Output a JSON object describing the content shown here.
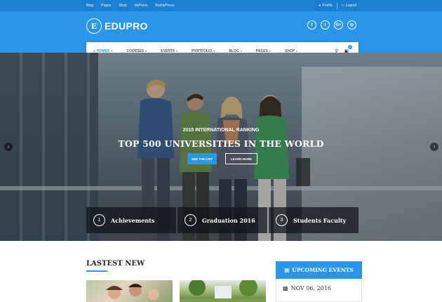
{
  "topbar": {
    "links": [
      "Blog",
      "Pages",
      "Shop",
      "bbPress",
      "BuddyPress"
    ],
    "profile": "Profile",
    "logout": "Logout"
  },
  "header": {
    "logo_mark": "E",
    "brand": "EDUPRO",
    "social_icons": [
      "facebook-icon",
      "twitter-icon",
      "google-plus-icon",
      "instagram-icon"
    ],
    "social_glyphs": [
      "f",
      "t",
      "G+",
      "◎"
    ]
  },
  "nav": {
    "items": [
      {
        "label": "Homes",
        "active": true
      },
      {
        "label": "Courses"
      },
      {
        "label": "Events"
      },
      {
        "label": "Portfolio"
      },
      {
        "label": "Blog"
      },
      {
        "label": "Pages"
      },
      {
        "label": "Shop"
      }
    ],
    "cart_count": "0"
  },
  "hero": {
    "kicker": "2015 INTERNATIONAL RANKING",
    "title": "TOP 500 UNIVERSITIES IN THE WORLD",
    "primary_button": "SEE THE LIST",
    "secondary_button": "LEARN MORE",
    "features": [
      {
        "number": "1",
        "label": "Achievements"
      },
      {
        "number": "2",
        "label": "Graduation 2016"
      },
      {
        "number": "3",
        "label": "Students Faculty"
      }
    ]
  },
  "latest": {
    "title": "LASTEST NEW"
  },
  "events": {
    "title": "UPCOMING EVENTS",
    "first_date": "NOV 06, 2016"
  },
  "colors": {
    "accent": "#2b95e9",
    "topbar": "#1c7fd1"
  }
}
